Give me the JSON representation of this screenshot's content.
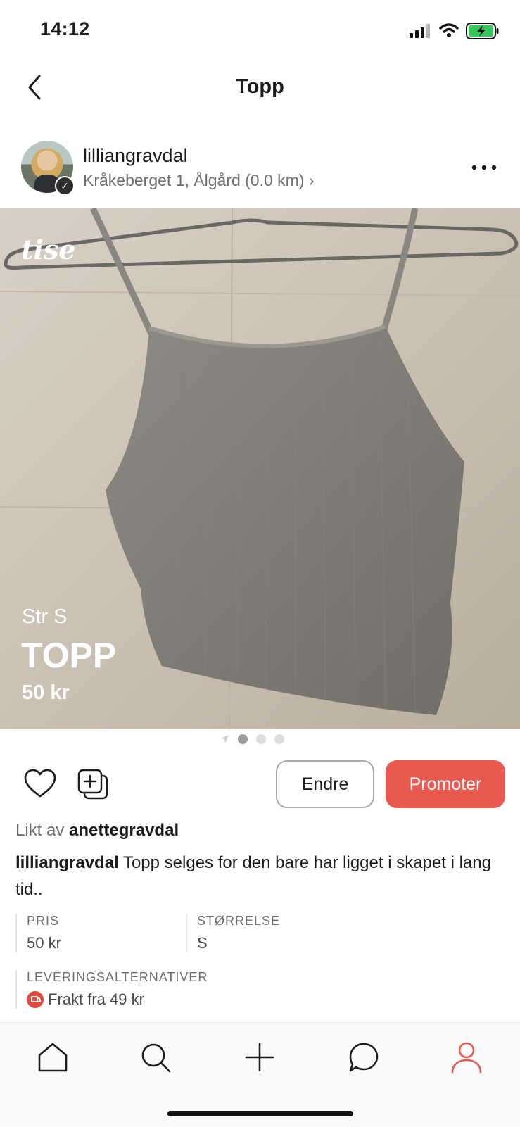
{
  "status_bar": {
    "time": "14:12"
  },
  "nav": {
    "title": "Topp"
  },
  "seller": {
    "username": "lilliangravdal",
    "location": "Kråkeberget 1, Ålgård (0.0 km) ›"
  },
  "photo": {
    "logo": "tise",
    "overlay_size": "Str S",
    "overlay_title": "TOPP",
    "overlay_price": "50 kr"
  },
  "pager": {
    "page_count": 3,
    "active_index": 0
  },
  "actions": {
    "edit_label": "Endre",
    "promote_label": "Promoter",
    "promote_color": "#e8594f"
  },
  "likes": {
    "prefix": "Likt av",
    "user": "anettegravdal"
  },
  "description": {
    "user": "lilliangravdal",
    "text": "Topp selges for den bare har ligget i skapet i lang tid.."
  },
  "details": {
    "price_label": "PRIS",
    "price_value": "50 kr",
    "size_label": "STØRRELSE",
    "size_value": "S",
    "shipping_label": "LEVERINGSALTERNATIVER",
    "shipping_value": "Frakt fra 49 kr"
  },
  "tabbar": {
    "tabs": [
      "home-icon",
      "search-icon",
      "add-icon",
      "chat-icon",
      "profile-icon"
    ],
    "active_tab": "profile-icon",
    "active_color": "#e8594f"
  }
}
